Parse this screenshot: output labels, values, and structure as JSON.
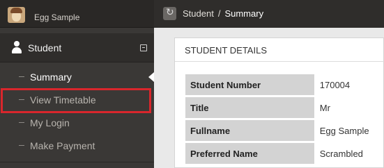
{
  "user": {
    "name": "Egg Sample"
  },
  "sidebar": {
    "section_title": "Student",
    "items": [
      {
        "label": "Summary",
        "active": true
      },
      {
        "label": "View Timetable",
        "highlighted": true
      },
      {
        "label": "My Login"
      },
      {
        "label": "Make Payment"
      }
    ]
  },
  "breadcrumb": {
    "parent": "Student",
    "separator": "/",
    "current": "Summary"
  },
  "panel": {
    "title": "STUDENT DETAILS",
    "rows": [
      {
        "key": "Student Number",
        "value": "170004"
      },
      {
        "key": "Title",
        "value": "Mr"
      },
      {
        "key": "Fullname",
        "value": "Egg Sample"
      },
      {
        "key": "Preferred Name",
        "value": "Scrambled"
      }
    ]
  },
  "colors": {
    "sidebar_bg": "#3a3836",
    "topbar_bg": "#2f2d2b",
    "highlight": "#d9262c",
    "label_cell": "#d3d3d3"
  }
}
